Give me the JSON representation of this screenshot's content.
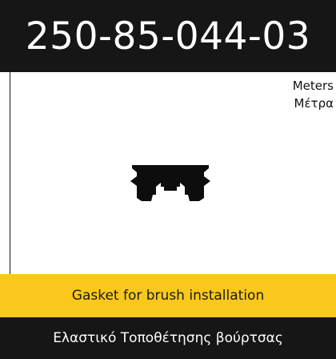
{
  "header": {
    "part_code": "250-85-044-03"
  },
  "units": {
    "line1": "Meters",
    "line2": "Μέτρα"
  },
  "profile": {
    "icon": "gasket-profile-icon",
    "color": "#0d0d0d"
  },
  "description": {
    "english": "Gasket for brush installation",
    "greek": "Ελαστικό Τοποθέτησης βούρτσας"
  },
  "colors": {
    "dark": "#161616",
    "accent_yellow": "#f8c81c"
  }
}
